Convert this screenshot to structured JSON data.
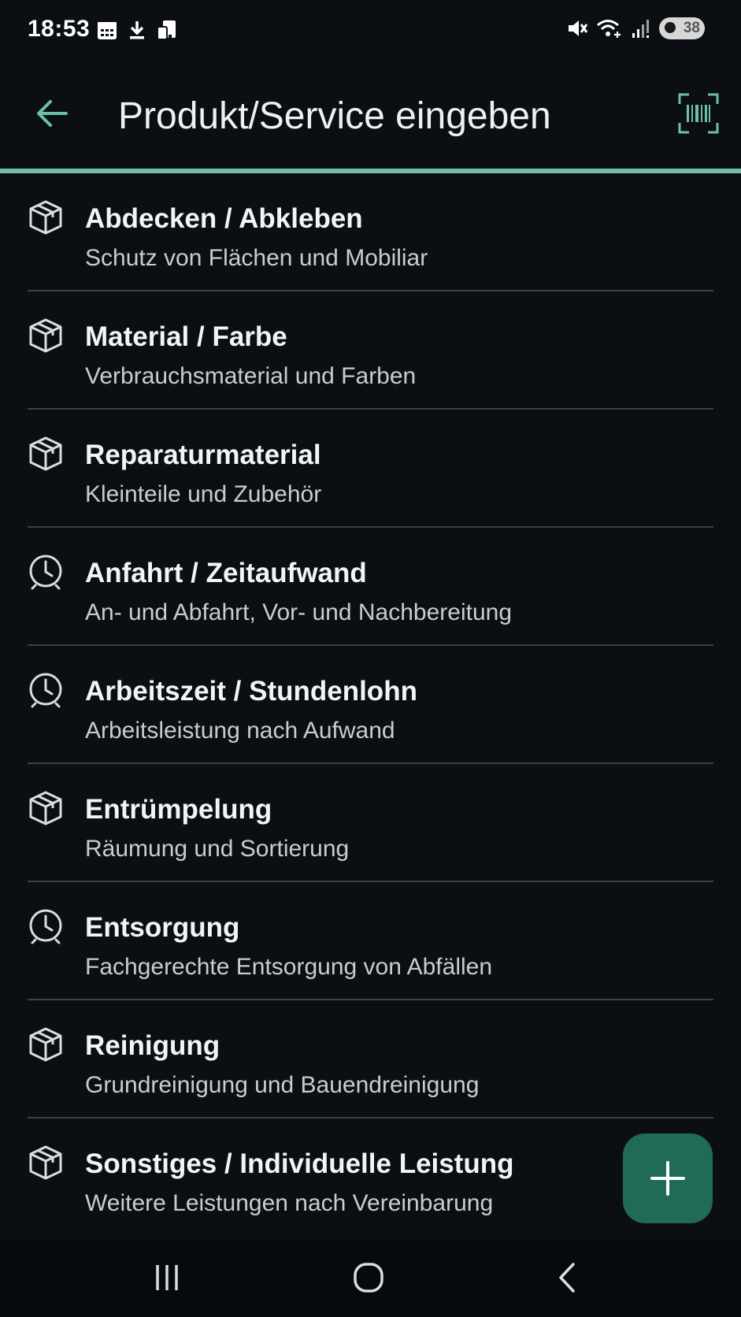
{
  "status_bar": {
    "time": "18:53",
    "battery_level": "38",
    "left_icons": [
      "calendar-icon",
      "download-icon",
      "device-icon"
    ],
    "right_icons": [
      "mute-icon",
      "wifi-icon",
      "signal-icon",
      "battery-icon"
    ]
  },
  "app_bar": {
    "title": "Produkt/Service eingeben",
    "back_icon": "arrow-left-icon",
    "scan_icon": "barcode-scan-icon"
  },
  "colors": {
    "accent": "#6fbfa6",
    "fab": "#1f6b56",
    "background": "#0b0f13"
  },
  "items": [
    {
      "title": "Abdecken / Abkleben",
      "subtitle": "Schutz von Flächen und Mobiliar",
      "icon": "box-icon"
    },
    {
      "title": "Material / Farbe",
      "subtitle": "Verbrauchsmaterial und Farben",
      "icon": "box-icon"
    },
    {
      "title": "Reparaturmaterial",
      "subtitle": "Kleinteile und Zubehör",
      "icon": "box-icon"
    },
    {
      "title": "Anfahrt / Zeitaufwand",
      "subtitle": "An- und Abfahrt, Vor- und Nachbereitung",
      "icon": "clock-icon"
    },
    {
      "title": "Arbeitszeit / Stundenlohn",
      "subtitle": "Arbeitsleistung nach Aufwand",
      "icon": "clock-icon"
    },
    {
      "title": "Entrümpelung",
      "subtitle": "Räumung und Sortierung",
      "icon": "box-icon"
    },
    {
      "title": "Entsorgung",
      "subtitle": "Fachgerechte Entsorgung von Abfällen",
      "icon": "clock-icon"
    },
    {
      "title": "Reinigung",
      "subtitle": "Grundreinigung und Bauendreinigung",
      "icon": "box-icon"
    },
    {
      "title": "Sonstiges / Individuelle Leistung",
      "subtitle": "Weitere Leistungen nach Vereinbarung",
      "icon": "box-icon"
    }
  ],
  "fab": {
    "icon": "plus-icon"
  },
  "nav_bar": {
    "buttons": [
      "recents-icon",
      "home-icon",
      "back-nav-icon"
    ]
  }
}
